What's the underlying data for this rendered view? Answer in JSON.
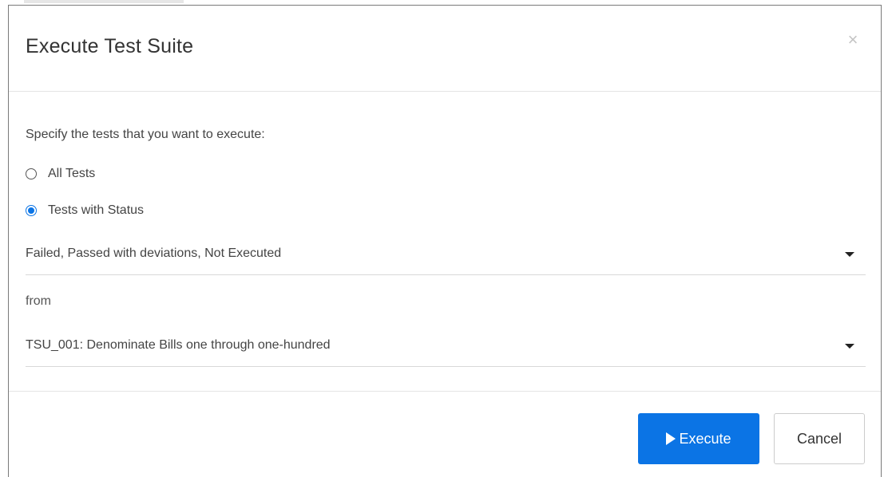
{
  "dialog": {
    "title": "Execute Test Suite",
    "close_glyph": "×",
    "close_icon": "close-icon"
  },
  "body": {
    "prompt": "Specify the tests that you want to execute:",
    "options": [
      {
        "label": "All Tests",
        "checked": false
      },
      {
        "label": "Tests with Status",
        "checked": true
      }
    ],
    "status_select": {
      "value": "Failed, Passed with deviations, Not Executed",
      "icon": "caret-down-icon"
    },
    "from_label": "from",
    "suite_select": {
      "value": "TSU_001: Denominate Bills one through one-hundred",
      "icon": "caret-down-icon"
    }
  },
  "footer": {
    "execute_label": "Execute",
    "execute_icon": "play-icon",
    "cancel_label": "Cancel"
  },
  "colors": {
    "primary": "#0b74e5",
    "text": "#333333",
    "divider": "#e5e5e5"
  }
}
